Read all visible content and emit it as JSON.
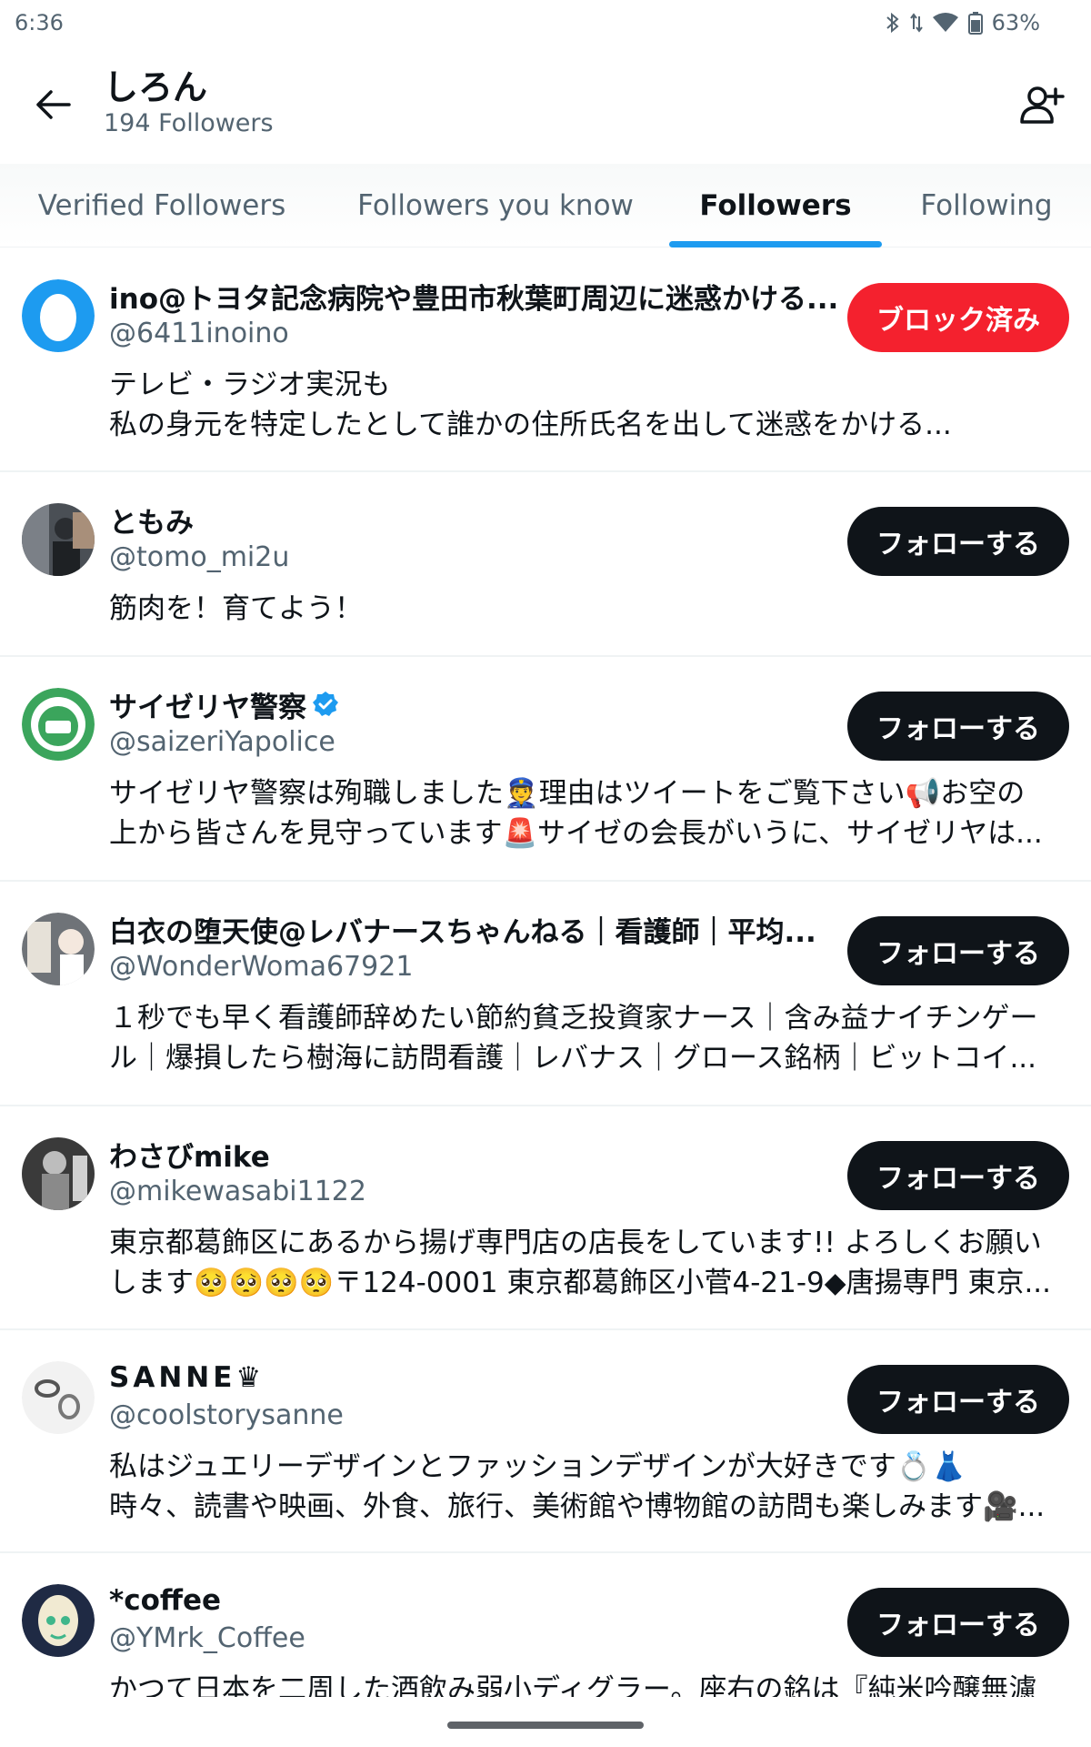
{
  "status_bar": {
    "time": "6:36",
    "battery": "63%",
    "icons": [
      "bluetooth-icon",
      "data-arrows-icon",
      "wifi-icon",
      "battery-icon"
    ]
  },
  "header": {
    "title": "しろん",
    "subtitle": "194 Followers",
    "back_icon": "back-arrow-icon",
    "add_icon": "add-user-icon"
  },
  "tabs": [
    {
      "label": "Verified Followers",
      "active": false
    },
    {
      "label": "Followers you know",
      "active": false
    },
    {
      "label": "Followers",
      "active": true
    },
    {
      "label": "Following",
      "active": false
    }
  ],
  "accent_color": "#1d9bf0",
  "blocked_color": "#f4212e",
  "followers": [
    {
      "name": "ino@トヨタ記念病院や豊田市秋葉町周辺に迷惑かける...",
      "handle": "@6411inoino",
      "verified": false,
      "button": "ブロック済み",
      "blocked": true,
      "bio": [
        "テレビ・ラジオ実況も",
        "私の身元を特定したとして誰かの住所氏名を出して迷惑をかける..."
      ]
    },
    {
      "name": "ともみ",
      "handle": "@tomo_mi2u",
      "verified": false,
      "button": "フォローする",
      "blocked": false,
      "bio": [
        "筋肉を！育てよう！"
      ]
    },
    {
      "name": "サイゼリヤ警察",
      "handle": "@saizeriYapolice",
      "verified": true,
      "button": "フォローする",
      "blocked": false,
      "bio": [
        "サイゼリヤ警察は殉職しました👮理由はツイートをご覧下さい📢お空の",
        "上から皆さんを見守っています🚨サイゼの会長がいうに、サイゼリヤは..."
      ]
    },
    {
      "name": "白衣の堕天使@レバナースちゃんねる｜看護師｜平均...",
      "handle": "@WonderWoma67921",
      "verified": false,
      "button": "フォローする",
      "blocked": false,
      "bio": [
        "１秒でも早く看護師辞めたい節約貧乏投資家ナース｜含み益ナイチンゲー",
        "ル｜爆損したら樹海に訪問看護｜レバナス｜グロース銘柄｜ビットコイ..."
      ]
    },
    {
      "name": "わさびmike",
      "handle": "@mikewasabi1122",
      "verified": false,
      "button": "フォローする",
      "blocked": false,
      "bio": [
        "東京都葛飾区にあるから揚げ専門店の店長をしています!! よろしくお願い",
        "します🥺🥺🥺🥺〒124-0001 東京都葛飾区小菅4-21-9◆唐揚専門 東京..."
      ]
    },
    {
      "name": "SANNE♛",
      "handle": "@coolstorysanne",
      "verified": false,
      "button": "フォローする",
      "blocked": false,
      "bio": [
        "私はジュエリーデザインとファッションデザインが大好きです💍👗",
        "時々、読書や映画、外食、旅行、美術館や博物館の訪問も楽しみます🎥..."
      ]
    },
    {
      "name": "*coffee",
      "handle": "@YMrk_Coffee",
      "verified": false,
      "button": "フォローする",
      "blocked": false,
      "bio": [
        "かつて日本を二周した酒飲み弱小ディグラー。座右の銘は『純米吟醸無濾"
      ]
    }
  ]
}
